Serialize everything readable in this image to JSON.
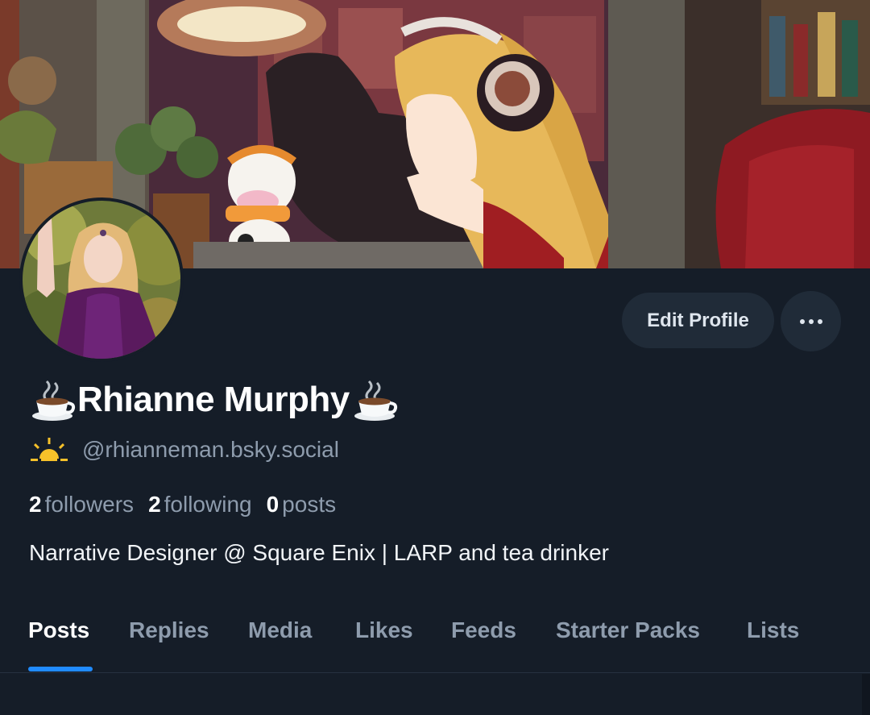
{
  "profile": {
    "display_name": "Rhianne Murphy",
    "name_prefix_emoji": "coffee-cup-icon",
    "name_suffix_emoji": "coffee-cup-icon",
    "handle_emoji": "sunrise-icon",
    "handle": "@rhianneman.bsky.social",
    "bio": "Narrative Designer @ Square Enix | LARP and tea drinker"
  },
  "stats": {
    "followers_count": "2",
    "followers_label": "followers",
    "following_count": "2",
    "following_label": "following",
    "posts_count": "0",
    "posts_label": "posts"
  },
  "actions": {
    "edit_profile_label": "Edit Profile",
    "more_icon": "more-horizontal-icon"
  },
  "tabs": [
    {
      "label": "Posts",
      "active": true
    },
    {
      "label": "Replies",
      "active": false
    },
    {
      "label": "Media",
      "active": false
    },
    {
      "label": "Likes",
      "active": false
    },
    {
      "label": "Feeds",
      "active": false
    },
    {
      "label": "Starter Packs",
      "active": false
    },
    {
      "label": "Lists",
      "active": false
    }
  ],
  "colors": {
    "background": "#151d28",
    "button_bg": "#202b38",
    "muted_text": "#8e9cad",
    "accent": "#208bfe"
  }
}
